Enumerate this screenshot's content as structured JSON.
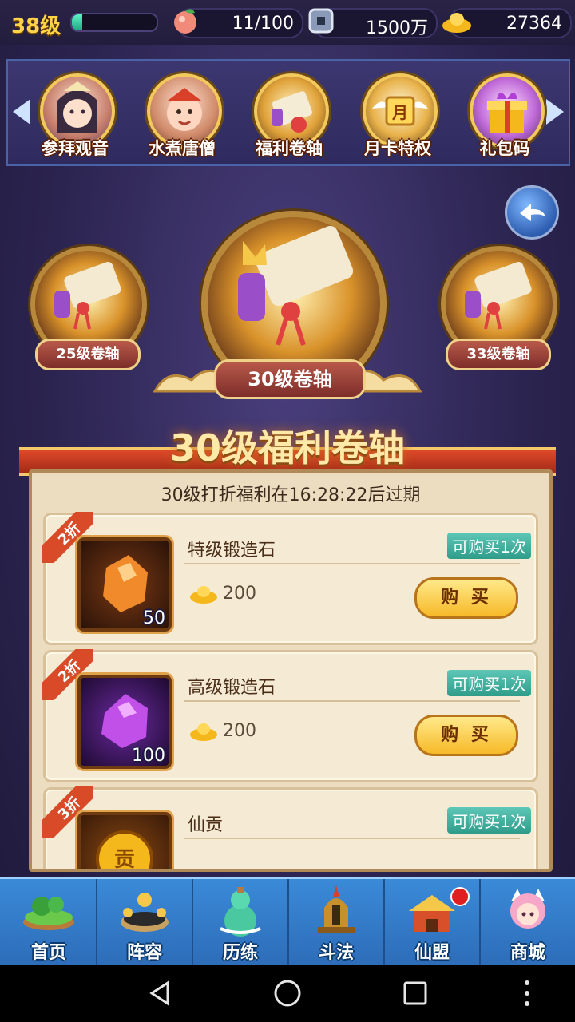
{
  "topbar": {
    "level": "38级",
    "xp_fraction": 0.12,
    "stamina": "11/100",
    "coins": "1500万",
    "gold": "27364"
  },
  "carousel": {
    "items": [
      {
        "label": "参拜观音",
        "icon": "guanyin-icon"
      },
      {
        "label": "水煮唐僧",
        "icon": "tang-monk-icon"
      },
      {
        "label": "福利卷轴",
        "icon": "scroll-icon"
      },
      {
        "label": "月卡特权",
        "icon": "month-card-icon"
      },
      {
        "label": "礼包码",
        "icon": "gift-box-icon"
      }
    ],
    "month_card_glyph": "月"
  },
  "scrolls": {
    "left": "25级卷轴",
    "center": "30级卷轴",
    "right": "33级卷轴"
  },
  "panel": {
    "title": "30级福利卷轴",
    "expire_text": "30级打折福利在16:28:22后过期",
    "items": [
      {
        "discount": "2折",
        "name": "特级锻造石",
        "qty": "50",
        "price": "200",
        "limit": "可购买1次",
        "buy": "购 买",
        "color": "#e3782a"
      },
      {
        "discount": "2折",
        "name": "高级锻造石",
        "qty": "100",
        "price": "200",
        "limit": "可购买1次",
        "buy": "购 买",
        "color": "#b040d8"
      },
      {
        "discount": "3折",
        "name": "仙贡",
        "qty": "",
        "price": "",
        "limit": "可购买1次",
        "buy": "",
        "color": "#e39a2a"
      }
    ],
    "coin_glyph": "贡"
  },
  "nav": {
    "tabs": [
      {
        "label": "首页",
        "icon": "island-icon"
      },
      {
        "label": "阵容",
        "icon": "lineup-icon"
      },
      {
        "label": "历练",
        "icon": "gourd-icon"
      },
      {
        "label": "斗法",
        "icon": "helmet-icon"
      },
      {
        "label": "仙盟",
        "icon": "palace-icon"
      },
      {
        "label": "商城",
        "icon": "shop-girl-icon"
      }
    ]
  }
}
